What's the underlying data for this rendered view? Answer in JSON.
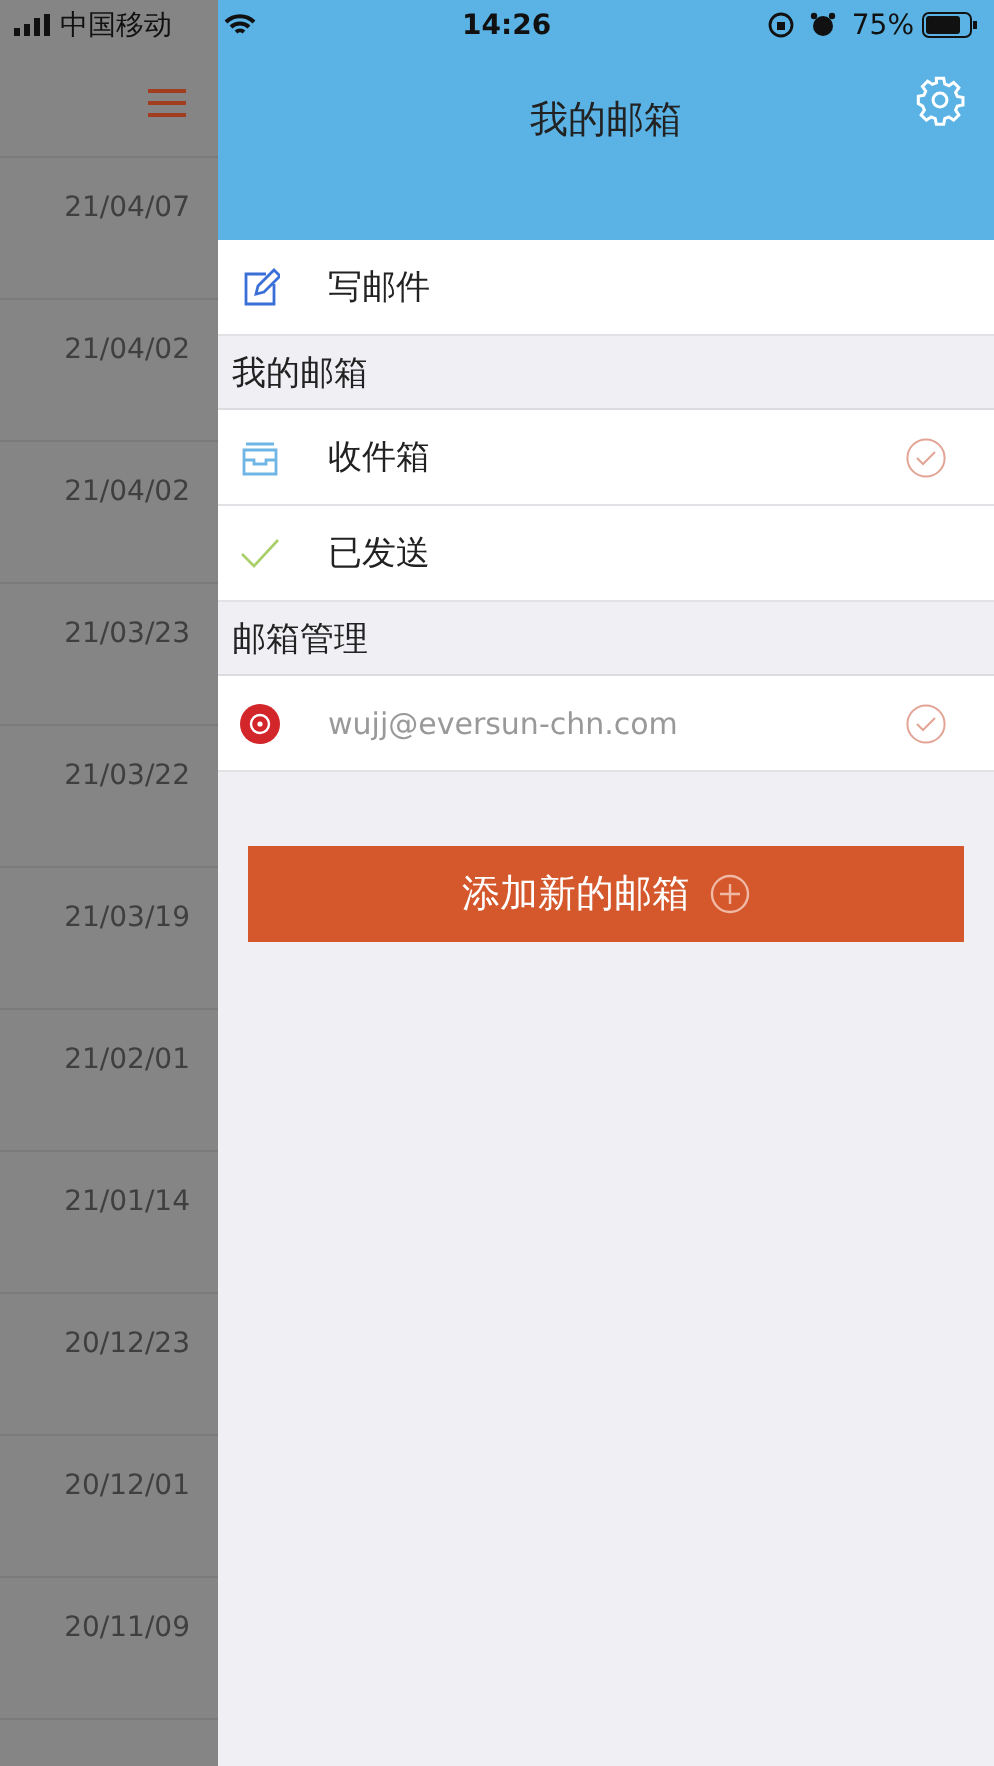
{
  "status_bar": {
    "carrier": "中国移动",
    "time": "14:26",
    "battery": "75%"
  },
  "list": {
    "dates": [
      "21/04/07",
      "21/04/02",
      "21/04/02",
      "21/03/23",
      "21/03/22",
      "21/03/19",
      "21/02/01",
      "21/01/14",
      "20/12/23",
      "20/12/01",
      "20/11/09"
    ]
  },
  "drawer": {
    "title": "我的邮箱",
    "sections": [
      {
        "items": [
          {
            "kind": "compose",
            "label": "写邮件",
            "checked": false
          }
        ]
      },
      {
        "header": "我的邮箱",
        "items": [
          {
            "kind": "inbox",
            "label": "收件箱",
            "checked": true
          },
          {
            "kind": "sent",
            "label": "已发送",
            "checked": false
          }
        ]
      },
      {
        "header": "邮箱管理",
        "items": [
          {
            "kind": "account",
            "label": "wujj@eversun-chn.com",
            "checked": true
          }
        ]
      }
    ],
    "add_button": "添加新的邮箱"
  }
}
